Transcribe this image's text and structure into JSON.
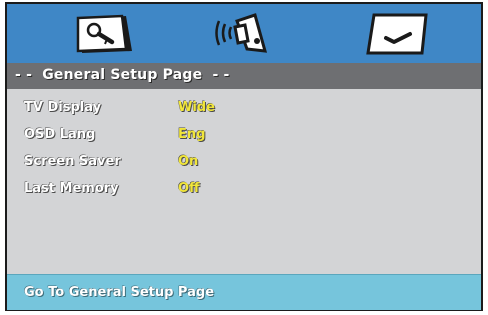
{
  "tabs": [
    {
      "icon": "wrench-setup-icon"
    },
    {
      "icon": "speaker-audio-icon"
    },
    {
      "icon": "checkmark-preferences-icon"
    }
  ],
  "title": "- -  General Setup Page  - -",
  "settings": [
    {
      "label": "TV Display",
      "value": "Wide"
    },
    {
      "label": "OSD Lang",
      "value": "Eng"
    },
    {
      "label": "Screen Saver",
      "value": "On"
    },
    {
      "label": "Last Memory",
      "value": "Off"
    }
  ],
  "footer": "Go To General Setup Page",
  "colors": {
    "topbar": "#3f87c6",
    "titlebar": "#6e6f72",
    "panel": "#d3d4d6",
    "footer": "#76c5dc",
    "value_text": "#f1e63a"
  }
}
